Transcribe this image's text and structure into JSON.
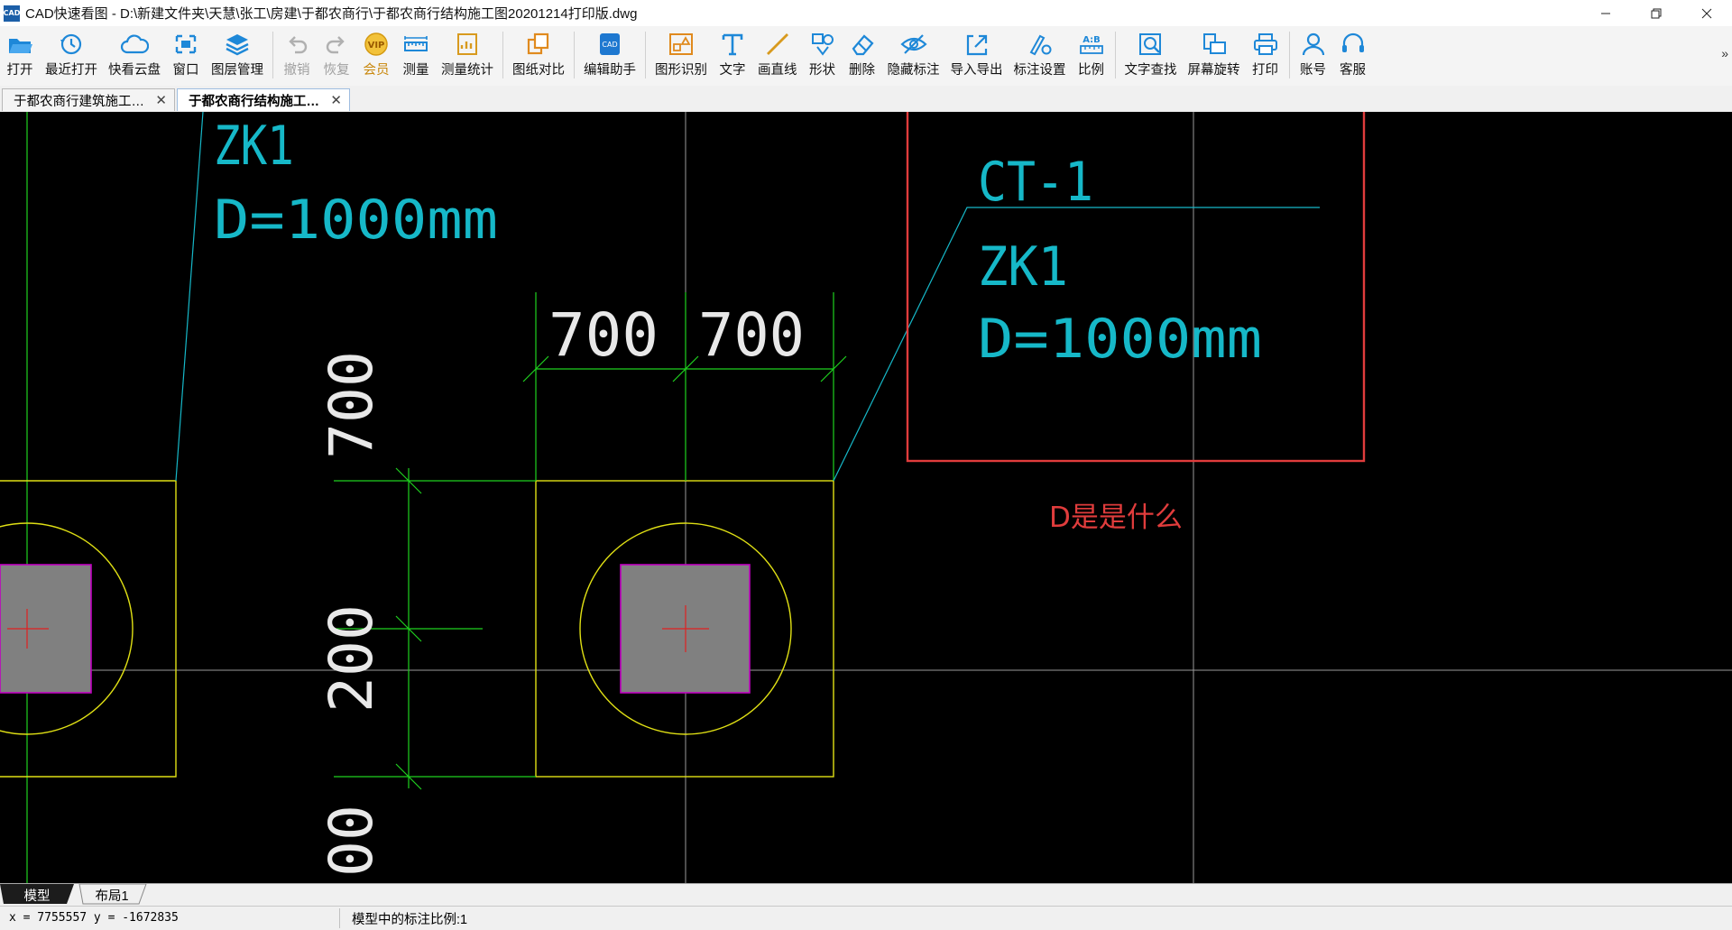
{
  "window": {
    "title": "CAD快速看图 - D:\\新建文件夹\\天慧\\张工\\房建\\于都农商行\\于都农商行结构施工图20201214打印版.dwg",
    "logo_text": "CAD"
  },
  "toolbar": {
    "items": [
      {
        "label": "打开",
        "icon": "folder-open-icon"
      },
      {
        "label": "最近打开",
        "icon": "recent-clock-icon"
      },
      {
        "label": "快看云盘",
        "icon": "cloud-icon"
      },
      {
        "label": "窗口",
        "icon": "window-icon"
      },
      {
        "label": "图层管理",
        "icon": "layers-icon"
      },
      {
        "label": "撤销",
        "icon": "undo-icon",
        "disabled": true
      },
      {
        "label": "恢复",
        "icon": "redo-icon",
        "disabled": true
      },
      {
        "label": "会员",
        "icon": "vip-icon",
        "icon_text": "VIP"
      },
      {
        "label": "测量",
        "icon": "ruler-icon"
      },
      {
        "label": "测量统计",
        "icon": "measure-stats-icon"
      },
      {
        "label": "图纸对比",
        "icon": "compare-icon"
      },
      {
        "label": "编辑助手",
        "icon": "edit-assistant-icon"
      },
      {
        "label": "图形识别",
        "icon": "shape-recognize-icon"
      },
      {
        "label": "文字",
        "icon": "text-t-icon"
      },
      {
        "label": "画直线",
        "icon": "line-icon"
      },
      {
        "label": "形状",
        "icon": "shapes-icon"
      },
      {
        "label": "删除",
        "icon": "eraser-icon"
      },
      {
        "label": "隐藏标注",
        "icon": "eye-hide-icon"
      },
      {
        "label": "导入导出",
        "icon": "import-export-icon"
      },
      {
        "label": "标注设置",
        "icon": "annotation-settings-icon"
      },
      {
        "label": "比例",
        "icon": "scale-icon",
        "icon_text": "A:B"
      },
      {
        "label": "文字查找",
        "icon": "text-search-icon"
      },
      {
        "label": "屏幕旋转",
        "icon": "rotate-screen-icon"
      },
      {
        "label": "打印",
        "icon": "printer-icon"
      },
      {
        "label": "账号",
        "icon": "user-icon"
      },
      {
        "label": "客服",
        "icon": "headset-icon"
      }
    ]
  },
  "tabs": [
    {
      "label": "于都农商行建筑施工…",
      "close": "✕"
    },
    {
      "label": "于都农商行结构施工…",
      "close": "✕",
      "active": true
    }
  ],
  "drawing": {
    "texts": {
      "zk1_top": "ZK1",
      "d_top": "D=1000mm",
      "ct1": "CT-1",
      "zk1_box": "ZK1",
      "d_box": "D=1000mm",
      "dim_700_a": "700",
      "dim_700_b": "700",
      "dim_700_v": "700",
      "dim_200_v": "200",
      "dim_00_v": "00",
      "question": "D是是什么"
    },
    "colors": {
      "cyan": "#16b8c8",
      "green": "#1fd11f",
      "yellow": "#e0e014",
      "red_annotation": "#e03c3c",
      "column_fill": "#808080",
      "column_border": "#c000c0",
      "grid_line": "#9a9a9a"
    }
  },
  "layout_tabs": [
    {
      "label": "模型",
      "active": true
    },
    {
      "label": "布局1"
    }
  ],
  "status": {
    "coords": "x = 7755557 y = -1672835",
    "scale": "模型中的标注比例:1"
  }
}
